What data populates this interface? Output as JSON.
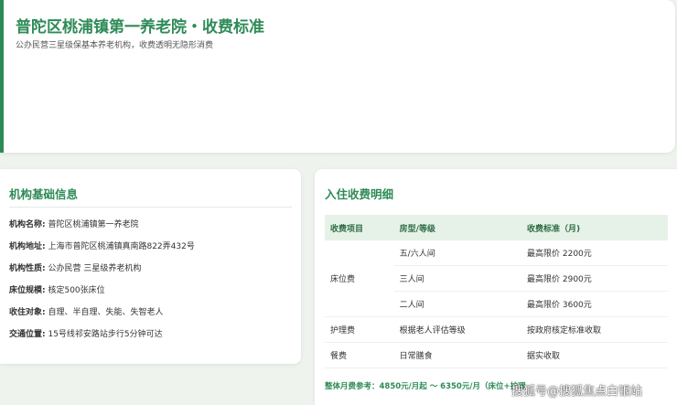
{
  "header": {
    "title": "普陀区桃浦镇第一养老院・收费标准",
    "subtitle": "公办民营三星级保基本养老机构，收费透明无隐形消费"
  },
  "info": {
    "title": "机构基础信息",
    "rows": [
      {
        "label": "机构名称:",
        "value": "普陀区桃浦镇第一养老院"
      },
      {
        "label": "机构地址:",
        "value": "上海市普陀区桃浦镇真南路822弄432号"
      },
      {
        "label": "机构性质:",
        "value": "公办民营 三星级养老机构"
      },
      {
        "label": "床位规模:",
        "value": "核定500张床位"
      },
      {
        "label": "收住对象:",
        "value": "自理、半自理、失能、失智老人"
      },
      {
        "label": "交通位置:",
        "value": "15号线祁安路站步行5分钟可达"
      }
    ]
  },
  "fees": {
    "title": "入住收费明细",
    "headers": [
      "收费项目",
      "房型/等级",
      "收费标准（月)"
    ],
    "bed_category": "床位费",
    "bed_rows": [
      {
        "type": "五/六人间",
        "price": "最高限价 2200元"
      },
      {
        "type": "三人间",
        "price": "最高限价 2900元"
      },
      {
        "type": "二人间",
        "price": "最高限价 3600元"
      }
    ],
    "other_rows": [
      {
        "item": "护理费",
        "type": "根据老人评估等级",
        "price": "按政府核定标准收取"
      },
      {
        "item": "餐费",
        "type": "日常膳食",
        "price": "据实收取"
      }
    ],
    "summary": "整体月费参考：4850元/月起 ～ 6350元/月（床位+护理"
  },
  "watermark": "搜狐号@搜狐焦点白银站",
  "colors": {
    "accent": "#2e8b57",
    "header_bg": "#e6f2e8",
    "page_bg": "#eef3ee"
  }
}
